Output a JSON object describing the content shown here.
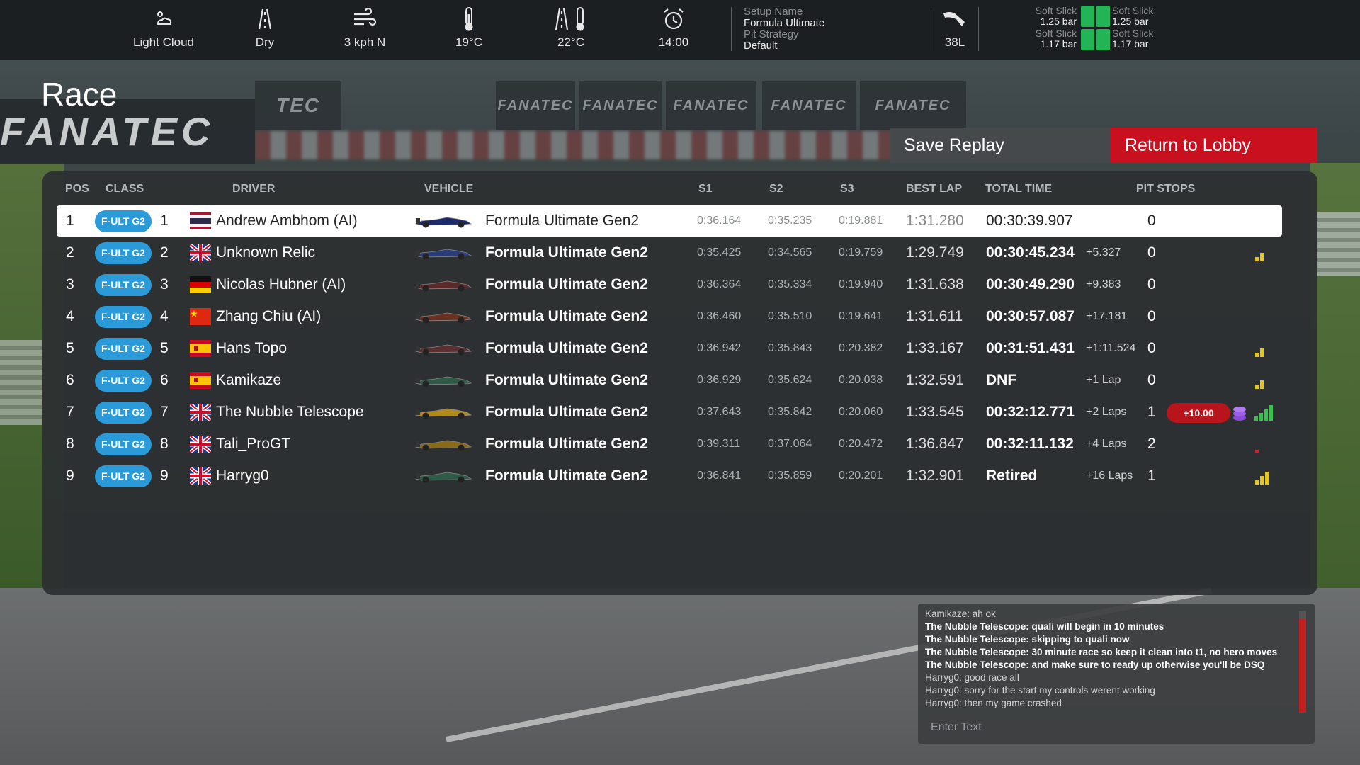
{
  "weather": {
    "cloud": "Light Cloud",
    "surface": "Dry",
    "wind": "3 kph  N",
    "air_temp": "19°C",
    "track_temp": "22°C",
    "time": "14:00"
  },
  "setup": {
    "name_label": "Setup Name",
    "name_value": "Formula Ultimate",
    "strategy_label": "Pit Strategy",
    "strategy_value": "Default"
  },
  "fuel": "38L",
  "tyres": {
    "front_left": {
      "compound": "Soft Slick",
      "pressure": "1.25 bar"
    },
    "front_right": {
      "compound": "Soft Slick",
      "pressure": "1.25 bar"
    },
    "rear_left": {
      "compound": "Soft Slick",
      "pressure": "1.17 bar"
    },
    "rear_right": {
      "compound": "Soft Slick",
      "pressure": "1.17 bar"
    }
  },
  "page_title": "Race",
  "buttons": {
    "save_replay": "Save Replay",
    "return_lobby": "Return to Lobby"
  },
  "columns": {
    "pos": "POS",
    "class": "CLASS",
    "driver": "DRIVER",
    "vehicle": "VEHICLE",
    "s1": "S1",
    "s2": "S2",
    "s3": "S3",
    "best_lap": "BEST LAP",
    "total_time": "TOTAL TIME",
    "pit_stops": "PIT STOPS"
  },
  "rows": [
    {
      "pos": "1",
      "class": "F-ULT G2",
      "num": "1",
      "flag": "thailand",
      "driver": "Andrew Ambhom  (AI)",
      "car_color": "#1c2a6a",
      "vehicle": "Formula Ultimate Gen2",
      "s1": "0:36.164",
      "s2": "0:35.235",
      "s3": "0:19.881",
      "best": "1:31.280",
      "total": "00:30:39.907",
      "gap": "",
      "pits": "0",
      "penalty": "",
      "signal": ""
    },
    {
      "pos": "2",
      "class": "F-ULT G2",
      "num": "2",
      "flag": "uk",
      "driver": "Unknown Relic",
      "car_color": "#2a3d7a",
      "vehicle": "Formula Ultimate Gen2",
      "s1": "0:35.425",
      "s2": "0:34.565",
      "s3": "0:19.759",
      "best": "1:29.749",
      "total": "00:30:45.234",
      "gap": "+5.327",
      "pits": "0",
      "penalty": "",
      "signal": "low"
    },
    {
      "pos": "3",
      "class": "F-ULT G2",
      "num": "3",
      "flag": "germany",
      "driver": "Nicolas Hubner  (AI)",
      "car_color": "#5a2a2a",
      "vehicle": "Formula Ultimate Gen2",
      "s1": "0:36.364",
      "s2": "0:35.334",
      "s3": "0:19.940",
      "best": "1:31.638",
      "total": "00:30:49.290",
      "gap": "+9.383",
      "pits": "0",
      "penalty": "",
      "signal": ""
    },
    {
      "pos": "4",
      "class": "F-ULT G2",
      "num": "4",
      "flag": "china",
      "driver": "Zhang Chiu  (AI)",
      "car_color": "#6a3020",
      "vehicle": "Formula Ultimate Gen2",
      "s1": "0:36.460",
      "s2": "0:35.510",
      "s3": "0:19.641",
      "best": "1:31.611",
      "total": "00:30:57.087",
      "gap": "+17.181",
      "pits": "0",
      "penalty": "",
      "signal": ""
    },
    {
      "pos": "5",
      "class": "F-ULT G2",
      "num": "5",
      "flag": "spain",
      "driver": "Hans Topo",
      "car_color": "#5a3030",
      "vehicle": "Formula Ultimate Gen2",
      "s1": "0:36.942",
      "s2": "0:35.843",
      "s3": "0:20.382",
      "best": "1:33.167",
      "total": "00:31:51.431",
      "gap": "+1:11.524",
      "pits": "0",
      "penalty": "",
      "signal": "low"
    },
    {
      "pos": "6",
      "class": "F-ULT G2",
      "num": "6",
      "flag": "spain",
      "driver": "Kamikaze",
      "car_color": "#2f5a48",
      "vehicle": "Formula Ultimate Gen2",
      "s1": "0:36.929",
      "s2": "0:35.624",
      "s3": "0:20.038",
      "best": "1:32.591",
      "total": "DNF",
      "gap": "+1 Lap",
      "pits": "0",
      "penalty": "",
      "signal": "low"
    },
    {
      "pos": "7",
      "class": "F-ULT G2",
      "num": "7",
      "flag": "uk",
      "driver": "The Nubble Telescope",
      "car_color": "#b08a1a",
      "vehicle": "Formula Ultimate Gen2",
      "s1": "0:37.643",
      "s2": "0:35.842",
      "s3": "0:20.060",
      "best": "1:33.545",
      "total": "00:32:12.771",
      "gap": "+2 Laps",
      "pits": "1",
      "penalty": "+10.00",
      "signal": "full"
    },
    {
      "pos": "8",
      "class": "F-ULT G2",
      "num": "8",
      "flag": "uk",
      "driver": "Tali_ProGT",
      "car_color": "#8a6a1a",
      "vehicle": "Formula Ultimate Gen2",
      "s1": "0:39.311",
      "s2": "0:37.064",
      "s3": "0:20.472",
      "best": "1:36.847",
      "total": "00:32:11.132",
      "gap": "+4 Laps",
      "pits": "2",
      "penalty": "",
      "signal": "red"
    },
    {
      "pos": "9",
      "class": "F-ULT G2",
      "num": "9",
      "flag": "uk",
      "driver": "Harryg0",
      "car_color": "#2f5a48",
      "vehicle": "Formula Ultimate Gen2",
      "s1": "0:36.841",
      "s2": "0:35.859",
      "s3": "0:20.201",
      "best": "1:32.901",
      "total": "Retired",
      "gap": "+16 Laps",
      "pits": "1",
      "penalty": "",
      "signal": "mid"
    }
  ],
  "chat": {
    "messages": [
      {
        "text": "Kamikaze: ah ok",
        "dim": true
      },
      {
        "text": "The Nubble Telescope: quali will begin in 10 minutes",
        "dim": false
      },
      {
        "text": "The Nubble Telescope: skipping to quali now",
        "dim": false
      },
      {
        "text": "The Nubble Telescope: 30 minute race so keep it clean into t1, no hero moves",
        "dim": false
      },
      {
        "text": "The Nubble Telescope: and make sure to ready up otherwise you'll be DSQ",
        "dim": false
      },
      {
        "text": "Harryg0: good race all",
        "dim": true
      },
      {
        "text": "Harryg0: sorry for the start my controls werent working",
        "dim": true
      },
      {
        "text": "Harryg0: then my game crashed",
        "dim": true
      }
    ],
    "placeholder": "Enter Text"
  },
  "sponsor": [
    "FANATEC",
    "FANATEC",
    "FANATEC",
    "FANATEC",
    "FANATEC",
    "TEC",
    "FANATEC"
  ],
  "colors": {
    "accent_red": "#c8101e",
    "class_badge": "#2a9ad8",
    "tyre_ok": "#22b455"
  }
}
